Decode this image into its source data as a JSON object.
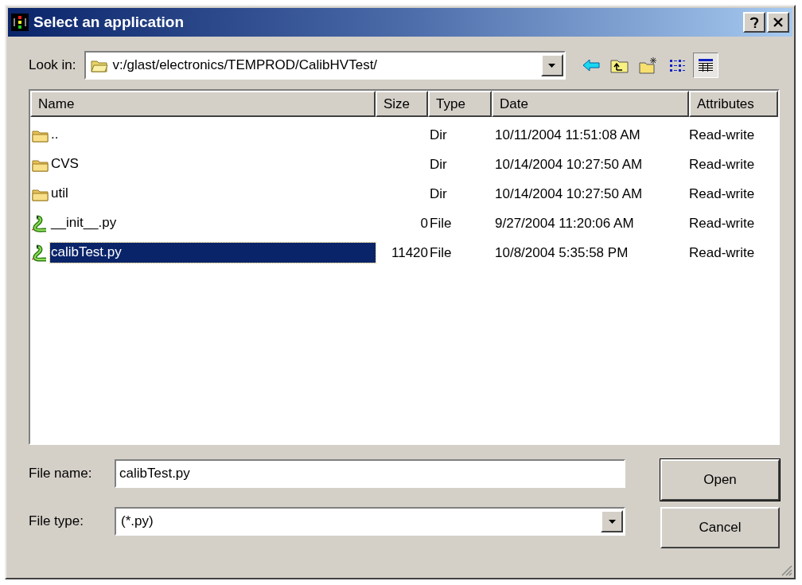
{
  "window": {
    "title": "Select an application"
  },
  "look_in": {
    "label": "Look in:",
    "path": "v:/glast/electronics/TEMPROD/CalibHVTest/"
  },
  "view_buttons": [
    {
      "kind": "list",
      "selected": false
    },
    {
      "kind": "details",
      "selected": true
    }
  ],
  "table": {
    "columns": [
      "Name",
      "Size",
      "Type",
      "Date",
      "Attributes"
    ],
    "rows": [
      {
        "kind": "folder",
        "name": "..",
        "size": "",
        "type": "Dir",
        "date": "10/11/2004 11:51:08 AM",
        "attributes": "Read-write",
        "selected": false
      },
      {
        "kind": "folder",
        "name": "CVS",
        "size": "",
        "type": "Dir",
        "date": "10/14/2004 10:27:50 AM",
        "attributes": "Read-write",
        "selected": false
      },
      {
        "kind": "folder",
        "name": "util",
        "size": "",
        "type": "Dir",
        "date": "10/14/2004 10:27:50 AM",
        "attributes": "Read-write",
        "selected": false
      },
      {
        "kind": "python",
        "name": "__init__.py",
        "size": "0",
        "type": "File",
        "date": "9/27/2004 11:20:06 AM",
        "attributes": "Read-write",
        "selected": false
      },
      {
        "kind": "python",
        "name": "calibTest.py",
        "size": "11420",
        "type": "File",
        "date": "10/8/2004 5:35:58 PM",
        "attributes": "Read-write",
        "selected": true
      }
    ]
  },
  "file_name": {
    "label": "File name:",
    "value": "calibTest.py"
  },
  "file_type": {
    "label": "File type:",
    "value": "(*.py)"
  },
  "buttons": [
    "Open",
    "Cancel"
  ]
}
